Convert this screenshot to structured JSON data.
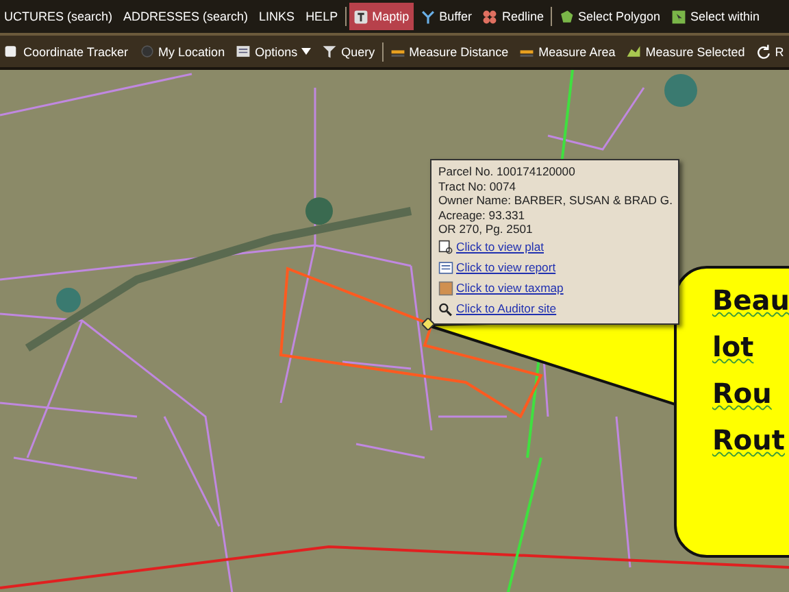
{
  "menu_links": [
    "UCTURES (search)",
    "ADDRESSES (search)",
    "LINKS",
    "HELP"
  ],
  "tools": [
    {
      "label": "Maptip",
      "selected": true
    },
    {
      "label": "Buffer",
      "selected": false
    },
    {
      "label": "Redline",
      "selected": false
    },
    {
      "label": "Select Polygon",
      "selected": false
    },
    {
      "label": "Select within",
      "selected": false
    }
  ],
  "toolbar": [
    "Coordinate Tracker",
    "My Location",
    "Options",
    "Query"
  ],
  "measure_tools": [
    "Measure Distance",
    "Measure Area",
    "Measure Selected",
    "R"
  ],
  "maptip": {
    "lines": [
      "Parcel No. 100174120000",
      "Tract No: 0074",
      "Owner Name: BARBER, SUSAN & BRAD G.",
      "Acreage: 93.331",
      "OR 270, Pg. 2501"
    ],
    "links": [
      "Click to view plat",
      "Click to view report",
      "Click to view taxmap",
      "Click to Auditor site"
    ]
  },
  "callout": {
    "lines": [
      "Beau",
      "lot",
      "Rou",
      "Rout"
    ]
  }
}
